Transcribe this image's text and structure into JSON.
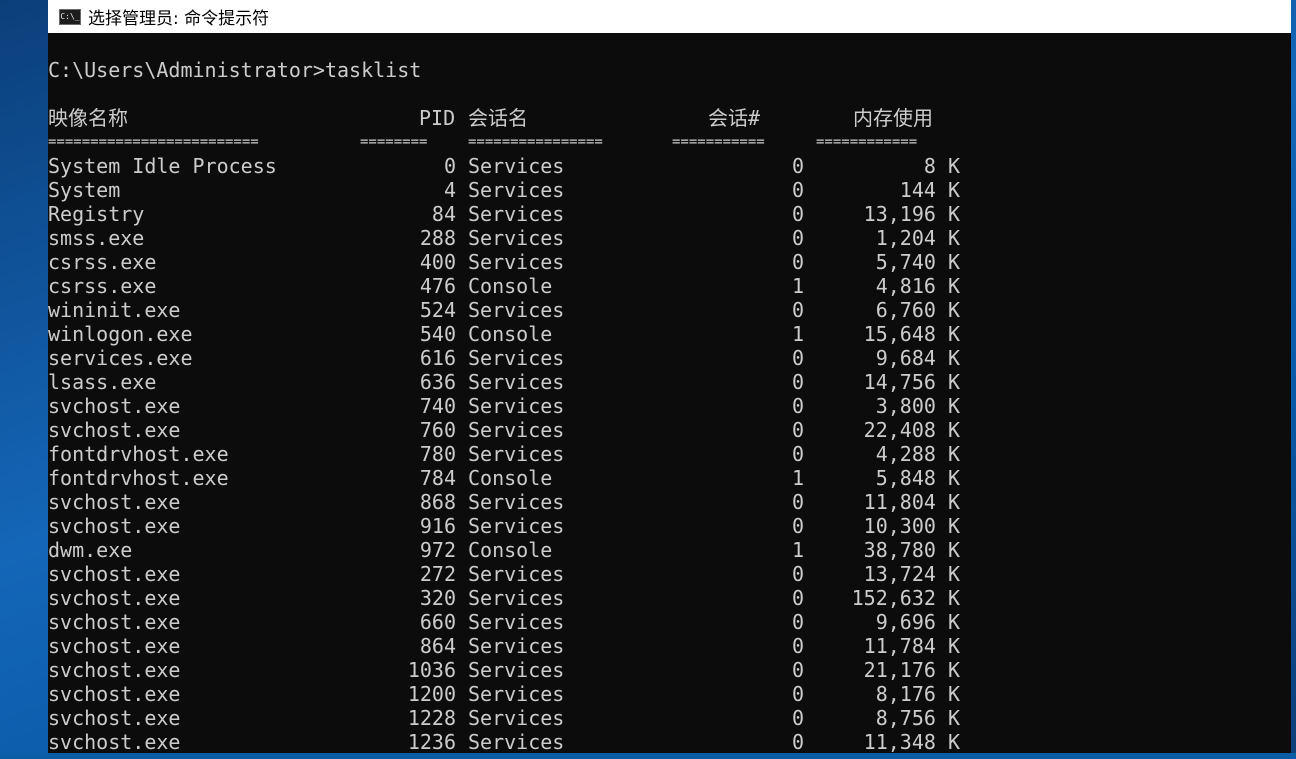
{
  "window": {
    "title": "选择管理员: 命令提示符",
    "icon": "cmd-icon",
    "icon_glyph": "C:\\_"
  },
  "console": {
    "prompt": "C:\\Users\\Administrator>tasklist",
    "headers": {
      "name": "映像名称",
      "pid": "PID",
      "session_name": "会话名",
      "session_num": "会话#",
      "mem": "内存使用"
    },
    "separators": {
      "name": "=========================",
      "pid": "========",
      "session_name": "================",
      "session_num": "===========",
      "mem": "============"
    },
    "rows": [
      {
        "name": "System Idle Process",
        "pid": "0",
        "session": "Services",
        "num": "0",
        "mem": "8 K"
      },
      {
        "name": "System",
        "pid": "4",
        "session": "Services",
        "num": "0",
        "mem": "144 K"
      },
      {
        "name": "Registry",
        "pid": "84",
        "session": "Services",
        "num": "0",
        "mem": "13,196 K"
      },
      {
        "name": "smss.exe",
        "pid": "288",
        "session": "Services",
        "num": "0",
        "mem": "1,204 K"
      },
      {
        "name": "csrss.exe",
        "pid": "400",
        "session": "Services",
        "num": "0",
        "mem": "5,740 K"
      },
      {
        "name": "csrss.exe",
        "pid": "476",
        "session": "Console",
        "num": "1",
        "mem": "4,816 K"
      },
      {
        "name": "wininit.exe",
        "pid": "524",
        "session": "Services",
        "num": "0",
        "mem": "6,760 K"
      },
      {
        "name": "winlogon.exe",
        "pid": "540",
        "session": "Console",
        "num": "1",
        "mem": "15,648 K"
      },
      {
        "name": "services.exe",
        "pid": "616",
        "session": "Services",
        "num": "0",
        "mem": "9,684 K"
      },
      {
        "name": "lsass.exe",
        "pid": "636",
        "session": "Services",
        "num": "0",
        "mem": "14,756 K"
      },
      {
        "name": "svchost.exe",
        "pid": "740",
        "session": "Services",
        "num": "0",
        "mem": "3,800 K"
      },
      {
        "name": "svchost.exe",
        "pid": "760",
        "session": "Services",
        "num": "0",
        "mem": "22,408 K"
      },
      {
        "name": "fontdrvhost.exe",
        "pid": "780",
        "session": "Services",
        "num": "0",
        "mem": "4,288 K"
      },
      {
        "name": "fontdrvhost.exe",
        "pid": "784",
        "session": "Console",
        "num": "1",
        "mem": "5,848 K"
      },
      {
        "name": "svchost.exe",
        "pid": "868",
        "session": "Services",
        "num": "0",
        "mem": "11,804 K"
      },
      {
        "name": "svchost.exe",
        "pid": "916",
        "session": "Services",
        "num": "0",
        "mem": "10,300 K"
      },
      {
        "name": "dwm.exe",
        "pid": "972",
        "session": "Console",
        "num": "1",
        "mem": "38,780 K"
      },
      {
        "name": "svchost.exe",
        "pid": "272",
        "session": "Services",
        "num": "0",
        "mem": "13,724 K"
      },
      {
        "name": "svchost.exe",
        "pid": "320",
        "session": "Services",
        "num": "0",
        "mem": "152,632 K"
      },
      {
        "name": "svchost.exe",
        "pid": "660",
        "session": "Services",
        "num": "0",
        "mem": "9,696 K"
      },
      {
        "name": "svchost.exe",
        "pid": "864",
        "session": "Services",
        "num": "0",
        "mem": "11,784 K"
      },
      {
        "name": "svchost.exe",
        "pid": "1036",
        "session": "Services",
        "num": "0",
        "mem": "21,176 K"
      },
      {
        "name": "svchost.exe",
        "pid": "1200",
        "session": "Services",
        "num": "0",
        "mem": "8,176 K"
      },
      {
        "name": "svchost.exe",
        "pid": "1228",
        "session": "Services",
        "num": "0",
        "mem": "8,756 K"
      },
      {
        "name": "svchost.exe",
        "pid": "1236",
        "session": "Services",
        "num": "0",
        "mem": "11,348 K"
      }
    ]
  },
  "colors": {
    "console_bg": "#0c0c0c",
    "console_fg": "#cccccc",
    "titlebar_bg": "#ffffff"
  }
}
